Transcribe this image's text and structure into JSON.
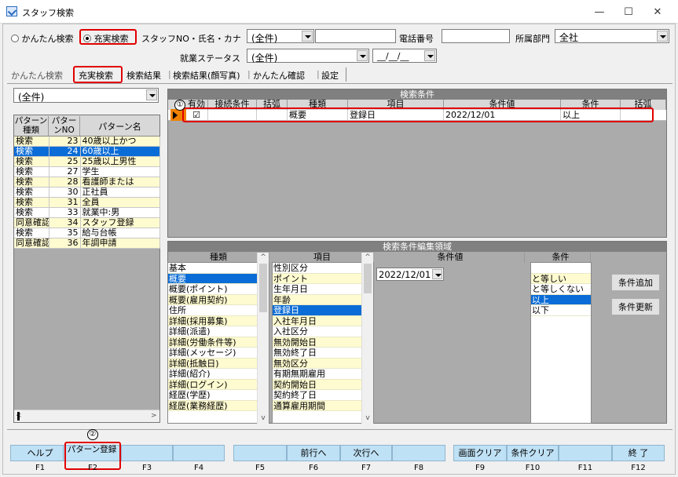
{
  "window": {
    "title": "スタッフ検索",
    "min": "—",
    "max": "☐",
    "close": "✕"
  },
  "search": {
    "easy_label": "かんたん検索",
    "full_label": "充実検索",
    "staff_label": "スタッフNO・氏名・カナ",
    "staff_select": "(全件)",
    "staff_text": "",
    "phone_label": "電話番号",
    "phone_value": "",
    "dept_label": "所属部門",
    "dept_value": "全社",
    "status_label": "就業ステータス",
    "status_value": "(全件)",
    "date_value": "__/__/__"
  },
  "tabs": [
    "かんたん検索",
    "充実検索",
    "検索結果",
    "検索結果(顔写真)",
    "かんたん確認",
    "設定"
  ],
  "left": {
    "filter": "(全件)",
    "headers": [
      "パターン種類",
      "パターンNO",
      "パターン名"
    ],
    "rows": [
      [
        "検索",
        "23",
        "40歳以上かつ"
      ],
      [
        "検索",
        "24",
        "60歳以上"
      ],
      [
        "検索",
        "25",
        "25歳以上男性"
      ],
      [
        "検索",
        "27",
        "学生"
      ],
      [
        "検索",
        "28",
        "看護師または"
      ],
      [
        "検索",
        "30",
        "正社員"
      ],
      [
        "検索",
        "31",
        "全員"
      ],
      [
        "検索",
        "33",
        "就業中:男"
      ],
      [
        "同意確認",
        "34",
        "スタッフ登録"
      ],
      [
        "検索",
        "35",
        "給与台帳"
      ],
      [
        "同意確認",
        "36",
        "年調申請"
      ]
    ]
  },
  "conditions": {
    "title": "検索条件",
    "marker": "①",
    "headers": [
      "有効",
      "接続条件",
      "括弧",
      "種類",
      "項目",
      "条件値",
      "条件",
      "括弧"
    ],
    "row": {
      "enabled": "☑",
      "conn": "",
      "paren1": "",
      "kind": "概要",
      "item": "登録日",
      "value": "2022/12/01",
      "cond": "以上",
      "paren2": ""
    }
  },
  "edit": {
    "title": "検索条件編集領域",
    "kind_header": "種類",
    "item_header": "項目",
    "value_header": "条件値",
    "cond_header": "条件",
    "kinds": [
      "基本",
      "概要",
      "概要(ポイント)",
      "概要(雇用契約)",
      "住所",
      "詳細(採用募集)",
      "詳細(派遣)",
      "詳細(労働条件等)",
      "詳細(メッセージ)",
      "詳細(抵触日)",
      "詳細(紹介)",
      "詳細(ログイン)",
      "経歴(学歴)",
      "経歴(業務経歴)"
    ],
    "items": [
      "性別区分",
      "ポイント",
      "生年月日",
      "年齢",
      "登録日",
      "入社年月日",
      "入社区分",
      "無効開始日",
      "無効終了日",
      "無効区分",
      "有期無期雇用",
      "契約開始日",
      "契約終了日",
      "通算雇用期間"
    ],
    "date": "2022/12/01",
    "conds": [
      "",
      "と等しい",
      "と等しくない",
      "以上",
      "以下"
    ],
    "add_button": "条件追加",
    "update_button": "条件更新"
  },
  "fkeys": {
    "marker": "②",
    "labels": [
      "ヘルプ",
      "パターン登録",
      "",
      "",
      "",
      "前行へ",
      "次行へ",
      "",
      "画面クリア",
      "条件クリア",
      "",
      "終 了"
    ],
    "keys": [
      "F1",
      "F2",
      "F3",
      "F4",
      "F5",
      "F6",
      "F7",
      "F8",
      "F9",
      "F10",
      "F11",
      "F12"
    ]
  }
}
